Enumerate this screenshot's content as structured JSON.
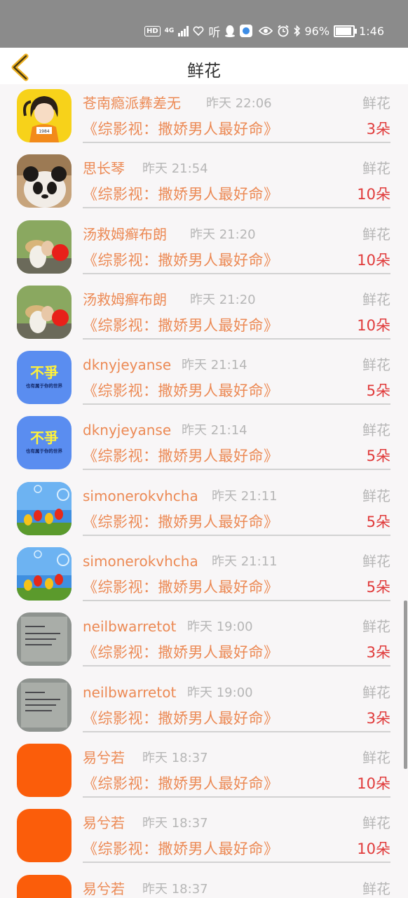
{
  "statusbar": {
    "hd": "HD",
    "network": "4G",
    "listen": "听",
    "battery": "96%",
    "time": "1:46"
  },
  "header": {
    "title": "鲜花"
  },
  "gift_label": "鲜花",
  "rows": [
    {
      "name": "苍南瘾派彝差无",
      "time": "昨天 22:06",
      "book": "《综影视：撒娇男人最好命》",
      "count": "3朵"
    },
    {
      "name": "思长琴",
      "time": "昨天 21:54",
      "book": "《综影视：撒娇男人最好命》",
      "count": "10朵"
    },
    {
      "name": "汤救姆癣布朗",
      "time": "昨天 21:20",
      "book": "《综影视：撒娇男人最好命》",
      "count": "10朵"
    },
    {
      "name": "汤救姆癣布朗",
      "time": "昨天 21:20",
      "book": "《综影视：撒娇男人最好命》",
      "count": "10朵"
    },
    {
      "name": "dknyjeyanse",
      "time": "昨天 21:14",
      "book": "《综影视：撒娇男人最好命》",
      "count": "5朵"
    },
    {
      "name": "dknyjeyanse",
      "time": "昨天 21:14",
      "book": "《综影视：撒娇男人最好命》",
      "count": "5朵"
    },
    {
      "name": "simonerokvhcha",
      "time": "昨天 21:11",
      "book": "《综影视：撒娇男人最好命》",
      "count": "5朵"
    },
    {
      "name": "simonerokvhcha",
      "time": "昨天 21:11",
      "book": "《综影视：撒娇男人最好命》",
      "count": "5朵"
    },
    {
      "name": "neilbwarretot",
      "time": "昨天 19:00",
      "book": "《综影视：撒娇男人最好命》",
      "count": "3朵"
    },
    {
      "name": "neilbwarretot",
      "time": "昨天 19:00",
      "book": "《综影视：撒娇男人最好命》",
      "count": "3朵"
    },
    {
      "name": "易兮若",
      "time": "昨天 18:37",
      "book": "《综影视：撒娇男人最好命》",
      "count": "10朵"
    },
    {
      "name": "易兮若",
      "time": "昨天 18:37",
      "book": "《综影视：撒娇男人最好命》",
      "count": "10朵"
    },
    {
      "name": "易兮若",
      "time": "昨天 18:37",
      "book": "",
      "count": ""
    }
  ],
  "avatar_texts": {
    "bu_zheng": "不爭",
    "bu_zheng_sub": "也有属于你的世界",
    "shirt": "1984"
  },
  "colors": {
    "accent_orange": "#ec8a55",
    "count_red": "#e03a3a",
    "muted_gray": "#b6b6b6",
    "back_arrow": "#f0b324"
  }
}
